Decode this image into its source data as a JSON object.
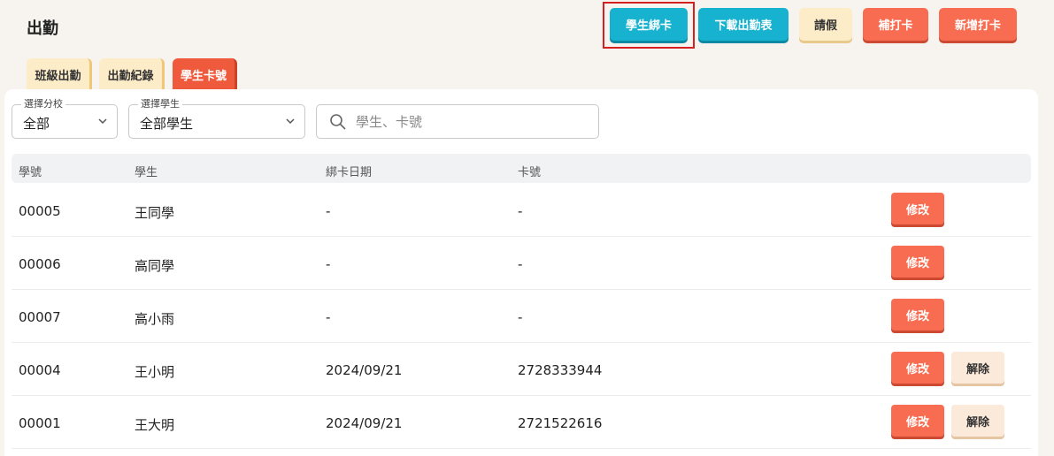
{
  "page": {
    "title": "出勤"
  },
  "toolbar": {
    "bind_card": "學生綁卡",
    "download_report": "下載出勤表",
    "leave": "請假",
    "makeup_punch": "補打卡",
    "add_punch": "新增打卡"
  },
  "tabs": [
    {
      "label": "班級出勤",
      "active": false
    },
    {
      "label": "出勤紀錄",
      "active": false
    },
    {
      "label": "學生卡號",
      "active": true
    }
  ],
  "filters": {
    "branch": {
      "legend": "選擇分校",
      "value": "全部"
    },
    "student": {
      "legend": "選擇學生",
      "value": "全部學生"
    },
    "search": {
      "placeholder": "學生、卡號",
      "value": ""
    }
  },
  "table": {
    "headers": [
      "學號",
      "學生",
      "綁卡日期",
      "卡號"
    ],
    "edit_label": "修改",
    "unbind_label": "解除",
    "rows": [
      {
        "id": "00005",
        "name": "王同學",
        "date": "-",
        "card": "-",
        "bound": false
      },
      {
        "id": "00006",
        "name": "高同學",
        "date": "-",
        "card": "-",
        "bound": false
      },
      {
        "id": "00007",
        "name": "高小雨",
        "date": "-",
        "card": "-",
        "bound": false
      },
      {
        "id": "00004",
        "name": "王小明",
        "date": "2024/09/21",
        "card": "2728333944",
        "bound": true
      },
      {
        "id": "00001",
        "name": "王大明",
        "date": "2024/09/21",
        "card": "2721522616",
        "bound": true
      }
    ]
  },
  "colors": {
    "accent_teal": "#17b2cf",
    "accent_orange": "#f86d52",
    "cream": "#fdecc8",
    "highlight": "#d42020"
  }
}
